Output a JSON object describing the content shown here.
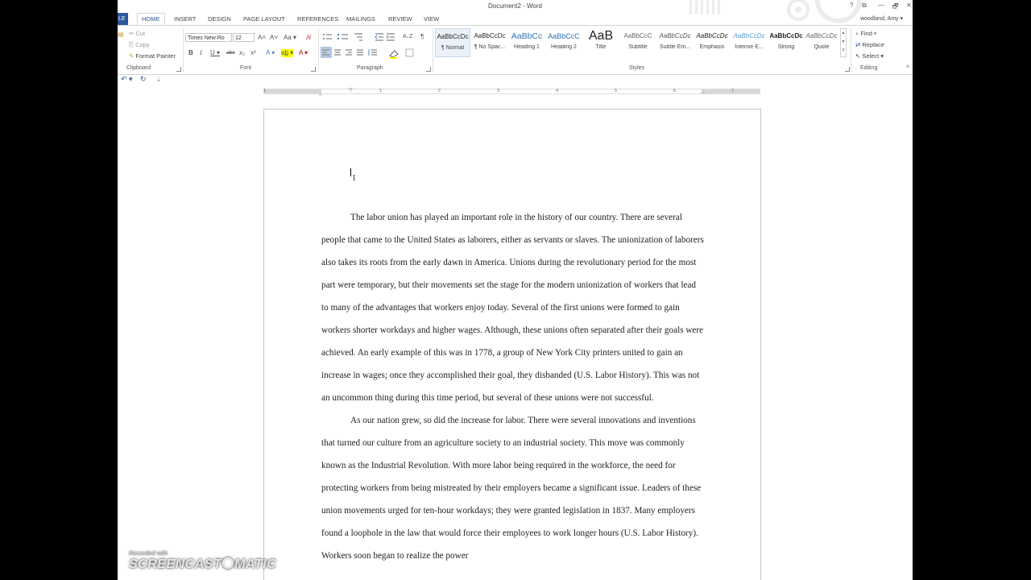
{
  "window": {
    "title": "Document2 - Word",
    "user": "woodland, Amy ▾",
    "controls": [
      "?",
      "⧉",
      "—",
      "🗗",
      "✕"
    ]
  },
  "tabs": {
    "file": "LE",
    "items": [
      "HOME",
      "INSERT",
      "DESIGN",
      "PAGE LAYOUT",
      "REFERENCES",
      "MAILINGS",
      "REVIEW",
      "VIEW"
    ],
    "active": "HOME"
  },
  "ribbon": {
    "clipboard": {
      "label": "Clipboard",
      "cut": "Cut",
      "copy": "Copy",
      "format_painter": "Format Painter"
    },
    "font": {
      "label": "Font",
      "font_name": "Times New Ro",
      "font_size": "12",
      "grow": "A˄",
      "shrink": "A˅",
      "change_case": "Aa ▾",
      "clear": "A̸",
      "bold": "B",
      "italic": "I",
      "underline": "U ▾",
      "strike": "abc",
      "subscript": "x₂",
      "superscript": "x²",
      "effects": "A ▾",
      "highlight": "ab̲ ▾",
      "color": "A ▾"
    },
    "paragraph": {
      "label": "Paragraph",
      "show_marks": "¶",
      "sort": "A↓Z"
    },
    "styles": {
      "label": "Styles",
      "items": [
        {
          "preview": "AaBbCcDc",
          "name": "¶ Normal"
        },
        {
          "preview": "AaBbCcDc",
          "name": "¶ No Spac..."
        },
        {
          "preview": "AaBbCc",
          "name": "Heading 1"
        },
        {
          "preview": "AaBbCcC",
          "name": "Heading 2"
        },
        {
          "preview": "AaB",
          "name": "Title"
        },
        {
          "preview": "AaBbCcC",
          "name": "Subtitle"
        },
        {
          "preview": "AaBbCcDc",
          "name": "Subtle Em..."
        },
        {
          "preview": "AaBbCcDc",
          "name": "Emphasis"
        },
        {
          "preview": "AaBbCcDc",
          "name": "Intense E..."
        },
        {
          "preview": "AaBbCcDc",
          "name": "Strong"
        },
        {
          "preview": "AaBbCcDc",
          "name": "Quote"
        }
      ]
    },
    "editing": {
      "label": "Editing",
      "find": "Find ▾",
      "replace": "Replace",
      "select": "Select ▾"
    }
  },
  "qat": {
    "undo": "↶ ▾",
    "redo": "↻",
    "customize": "⇣"
  },
  "ruler": {
    "ticks": [
      "1",
      "1",
      "2",
      "3",
      "4",
      "5",
      "6",
      "7"
    ]
  },
  "document": {
    "paragraphs": [
      "The labor union has played an important role in the history of our country. There are several people that came to the United States as laborers, either as servants or slaves. The unionization of laborers also takes its roots from the early dawn in America. Unions during the revolutionary period for the most part were temporary, but their movements set the stage for the modern unionization of workers that lead to many of the advantages that workers enjoy today. Several of the first unions were formed to gain workers shorter workdays and higher wages. Although, these unions often separated after their goals were achieved. An early example of this was in 1778, a group of New York City printers united to gain an increase in wages; once they accomplished their goal, they disbanded (U.S. Labor History). This was not an uncommon thing during this time period, but several of these unions were not successful.",
      "As our nation grew, so did the increase for labor. There were several innovations and inventions that turned our culture from an agriculture society to an industrial society. This move was commonly known as the Industrial Revolution. With more labor being required in the workforce, the need for protecting workers from being mistreated by their employers became a significant issue. Leaders of these union movements urged for ten-hour workdays; they were granted legislation in 1837. Many employers found a loophole in the law that would force their employees to work longer hours (U.S. Labor History). Workers soon began to realize the power"
    ]
  },
  "watermark": {
    "recorded": "Recorded with",
    "brand_left": "SCREENCAST",
    "brand_right": "MATIC"
  }
}
